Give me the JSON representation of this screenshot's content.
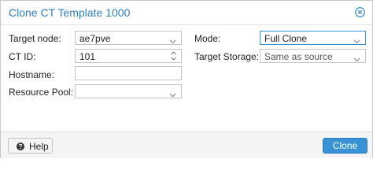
{
  "dialog": {
    "title": "Clone CT Template 1000"
  },
  "form": {
    "target_node": {
      "label": "Target node:",
      "value": "ae7pve"
    },
    "ct_id": {
      "label": "CT ID:",
      "value": "101"
    },
    "hostname": {
      "label": "Hostname:",
      "value": ""
    },
    "resource_pool": {
      "label": "Resource Pool:",
      "value": ""
    },
    "mode": {
      "label": "Mode:",
      "value": "Full Clone"
    },
    "target_storage": {
      "label": "Target Storage:",
      "value": "Same as source"
    }
  },
  "footer": {
    "help_label": "Help",
    "clone_label": "Clone"
  },
  "colors": {
    "title": "#2f7fc4",
    "accent": "#3892d4"
  }
}
